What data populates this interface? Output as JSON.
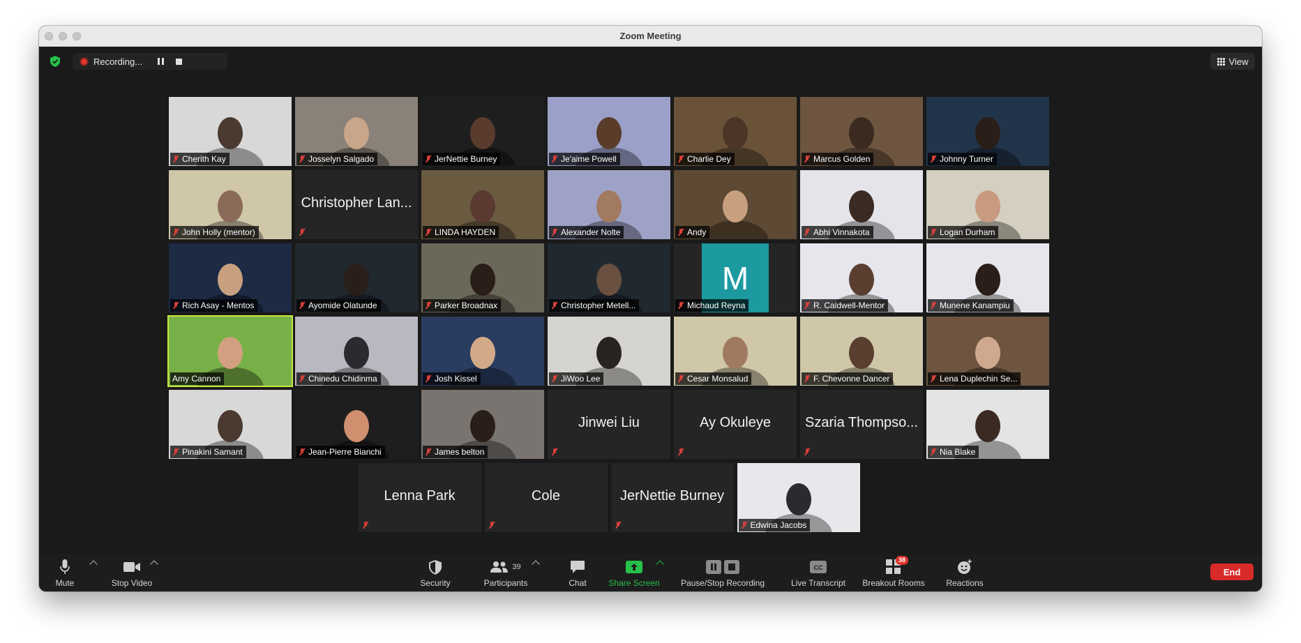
{
  "window": {
    "title": "Zoom Meeting"
  },
  "topbar": {
    "recording_label": "Recording...",
    "view_label": "View"
  },
  "participants": [
    {
      "name": "Cherith Kay",
      "type": "video",
      "bg": "#d8d8d8",
      "fg": "#4a3a30"
    },
    {
      "name": "Josselyn Salgado",
      "type": "video",
      "bg": "#8a8178",
      "fg": "#c9a58a"
    },
    {
      "name": "JerNettie Burney",
      "type": "video",
      "bg": "#1e1e1e",
      "fg": "#5a3c2e"
    },
    {
      "name": "Je'aime Powell",
      "type": "video",
      "bg": "#9aa0c8",
      "fg": "#5a3c2a"
    },
    {
      "name": "Charlie Dey",
      "type": "video",
      "bg": "#6a5238",
      "fg": "#4a3526"
    },
    {
      "name": "Marcus Golden",
      "type": "video",
      "bg": "#6d5540",
      "fg": "#3a2a20"
    },
    {
      "name": "Johnny Turner",
      "type": "video",
      "bg": "#22344a",
      "fg": "#2a1e18"
    },
    {
      "name": "John Holly (mentor)",
      "type": "video",
      "bg": "#cfc7a8",
      "fg": "#8a6a58"
    },
    {
      "name": "Christopher Lan...",
      "type": "text"
    },
    {
      "name": "LINDA HAYDEN",
      "type": "video",
      "bg": "#6a5a40",
      "fg": "#5a3a30"
    },
    {
      "name": "Alexander Nolte",
      "type": "video",
      "bg": "#9ea2c6",
      "fg": "#a27a62"
    },
    {
      "name": "Andy",
      "type": "video",
      "bg": "#5e4a34",
      "fg": "#c8a080"
    },
    {
      "name": "Abhi Vinnakota",
      "type": "video",
      "bg": "#e4e4ea",
      "fg": "#3a2a24"
    },
    {
      "name": "Logan Durham",
      "type": "video",
      "bg": "#d4cfc0",
      "fg": "#c89a80"
    },
    {
      "name": "Rich Asay - Mentos",
      "type": "video",
      "bg": "#1c2a44",
      "fg": "#c8a080"
    },
    {
      "name": "Ayomide Olatunde",
      "type": "video",
      "bg": "#202830",
      "fg": "#2a1e18"
    },
    {
      "name": "Parker Broadnax",
      "type": "video",
      "bg": "#6a6858",
      "fg": "#2a1e18"
    },
    {
      "name": "Christopher Metell...",
      "type": "video",
      "bg": "#202830",
      "fg": "#6a5040"
    },
    {
      "name": "Michaud Reyna",
      "type": "avatar",
      "letter": "M",
      "bg": "#1c9aa0"
    },
    {
      "name": "R. Caldwell-Mentor",
      "type": "video",
      "bg": "#e6e6ec",
      "fg": "#5a3e30"
    },
    {
      "name": "Munene Kanampiu",
      "type": "video",
      "bg": "#e6e6ec",
      "fg": "#2a1e18"
    },
    {
      "name": "Amy Cannon",
      "type": "video",
      "bg": "#78b048",
      "fg": "#d2a080",
      "active": true
    },
    {
      "name": "Chinedu Chidinma",
      "type": "video",
      "bg": "#b8b8c0",
      "fg": "#2a2a30"
    },
    {
      "name": "Josh Kissel",
      "type": "video",
      "bg": "#2a3c60",
      "fg": "#d2aa88"
    },
    {
      "name": "JiWoo Lee",
      "type": "video",
      "bg": "#d6d4d0",
      "fg": "#2a2420"
    },
    {
      "name": "Cesar Monsalud",
      "type": "video",
      "bg": "#cfc7a8",
      "fg": "#a07a60"
    },
    {
      "name": "F. Chevonne Dancer",
      "type": "video",
      "bg": "#cfc7a8",
      "fg": "#5a3e30"
    },
    {
      "name": "Lena Duplechin Se...",
      "type": "video",
      "bg": "#6d5540",
      "fg": "#d0a890"
    },
    {
      "name": "Pinakini Samant",
      "type": "video",
      "bg": "#d8d8d8",
      "fg": "#4a3a30"
    },
    {
      "name": "Jean-Pierre Bianchi",
      "type": "video",
      "bg": "#1e1e1e",
      "fg": "#d09070"
    },
    {
      "name": "James belton",
      "type": "video",
      "bg": "#7a7470",
      "fg": "#2a1e18"
    },
    {
      "name": "Jinwei Liu",
      "type": "text"
    },
    {
      "name": "Ay Okuleye",
      "type": "text"
    },
    {
      "name": "Szaria Thompso...",
      "type": "text"
    },
    {
      "name": "Nia Blake",
      "type": "video",
      "bg": "#e4e4e4",
      "fg": "#3a2a22"
    },
    {
      "name": "Lenna Park",
      "type": "text"
    },
    {
      "name": "Cole",
      "type": "text"
    },
    {
      "name": "JerNettie Burney",
      "type": "text"
    },
    {
      "name": "Edwina Jacobs",
      "type": "video",
      "bg": "#e8e8ec",
      "fg": "#2a2a30"
    }
  ],
  "toolbar": {
    "mute": "Mute",
    "stop_video": "Stop Video",
    "security": "Security",
    "participants": "Participants",
    "participant_count": "39",
    "chat": "Chat",
    "share_screen": "Share Screen",
    "pause_stop_recording": "Pause/Stop Recording",
    "live_transcript": "Live Transcript",
    "breakout_rooms": "Breakout Rooms",
    "breakout_badge": "38",
    "reactions": "Reactions",
    "end": "End"
  },
  "colors": {
    "accent_green": "#27c04a",
    "end_red": "#d92a2a",
    "active_speaker": "#c8e83c"
  }
}
